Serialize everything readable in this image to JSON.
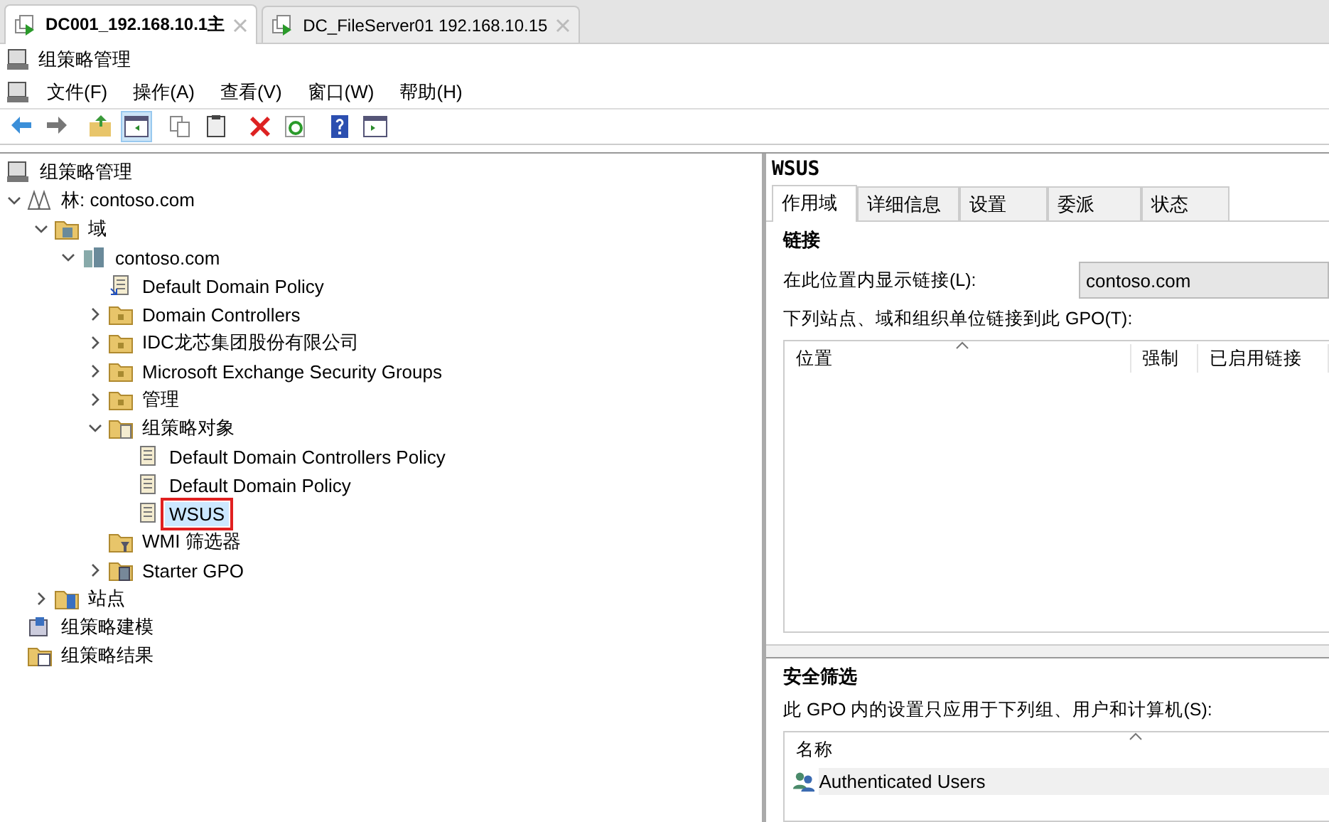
{
  "tabs": [
    {
      "label": "DC001_192.168.10.1主",
      "selected": true
    },
    {
      "label": "DC_FileServer01 192.168.10.15",
      "selected": false
    }
  ],
  "window": {
    "title": "组策略管理"
  },
  "menu": [
    "文件(F)",
    "操作(A)",
    "查看(V)",
    "窗口(W)",
    "帮助(H)"
  ],
  "toolbar": [
    {
      "kind": "back",
      "pressed": false
    },
    {
      "kind": "forward",
      "pressed": false
    },
    {
      "kind": "up",
      "pressed": false
    },
    {
      "kind": "tree",
      "pressed": true
    },
    {
      "kind": "copy",
      "pressed": false
    },
    {
      "kind": "paste",
      "pressed": false
    },
    {
      "kind": "delete",
      "pressed": false
    },
    {
      "kind": "refresh",
      "pressed": false
    },
    {
      "kind": "help",
      "pressed": false
    },
    {
      "kind": "pane",
      "pressed": false
    }
  ],
  "tree": {
    "label": "组策略管理",
    "kind": "console",
    "children": [
      {
        "label": "林: contoso.com",
        "kind": "forest",
        "expanded": true,
        "selected": false,
        "children": [
          {
            "label": "域",
            "kind": "domains",
            "expanded": true,
            "selected": false,
            "children": [
              {
                "label": "contoso.com",
                "kind": "domain",
                "expanded": true,
                "selected": false,
                "children": [
                  {
                    "label": "Default Domain Policy",
                    "kind": "link",
                    "selected": false
                  },
                  {
                    "label": "Domain Controllers",
                    "kind": "ou",
                    "expanded": false,
                    "selected": false
                  },
                  {
                    "label": "IDC龙芯集团股份有限公司",
                    "kind": "ou",
                    "expanded": false,
                    "selected": false
                  },
                  {
                    "label": "Microsoft Exchange Security Groups",
                    "kind": "ou",
                    "expanded": false,
                    "selected": false
                  },
                  {
                    "label": "管理",
                    "kind": "ou",
                    "expanded": false,
                    "selected": false
                  },
                  {
                    "label": "组策略对象",
                    "kind": "gpos",
                    "expanded": true,
                    "selected": false,
                    "children": [
                      {
                        "label": "Default Domain Controllers Policy",
                        "kind": "gpo",
                        "selected": false
                      },
                      {
                        "label": "Default Domain Policy",
                        "kind": "gpo",
                        "selected": false
                      },
                      {
                        "label": "WSUS",
                        "kind": "gpo",
                        "selected": true
                      }
                    ]
                  },
                  {
                    "label": "WMI 筛选器",
                    "kind": "wmi",
                    "selected": false
                  },
                  {
                    "label": "Starter GPO",
                    "kind": "starter",
                    "expanded": false,
                    "selected": false
                  }
                ]
              }
            ]
          },
          {
            "label": "站点",
            "kind": "sites",
            "expanded": false,
            "selected": false
          }
        ]
      },
      {
        "label": "组策略建模",
        "kind": "modeling",
        "selected": false
      },
      {
        "label": "组策略结果",
        "kind": "results",
        "selected": false
      }
    ]
  },
  "details": {
    "title": "WSUS",
    "tabs": [
      {
        "label": "作用域",
        "selected": true
      },
      {
        "label": "详细信息",
        "selected": false
      },
      {
        "label": "设置",
        "selected": false
      },
      {
        "label": "委派",
        "selected": false
      },
      {
        "label": "状态",
        "selected": false
      }
    ],
    "links": {
      "heading": "链接",
      "location_label": "在此位置内显示链接(L):",
      "location_value": "contoso.com",
      "list_label": "下列站点、域和组织单位链接到此 GPO(T):",
      "columns": [
        "位置",
        "强制",
        "已启用链接"
      ]
    },
    "security": {
      "heading": "安全筛选",
      "list_label": "此 GPO 内的设置只应用于下列组、用户和计算机(S):",
      "columns": [
        "名称"
      ],
      "rows": [
        "Authenticated Users"
      ]
    }
  }
}
